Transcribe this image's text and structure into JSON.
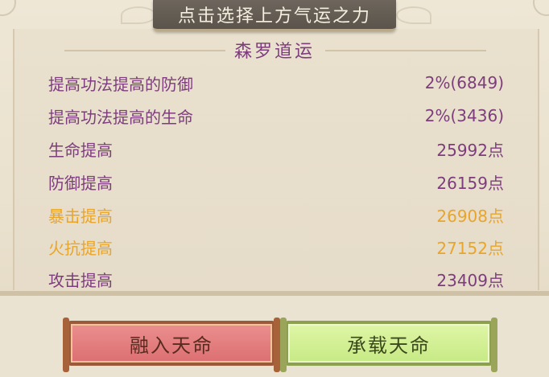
{
  "header": {
    "title": "点击选择上方气运之力"
  },
  "section": {
    "title": "森罗道运"
  },
  "stats": [
    {
      "label": "提高功法提高的防御",
      "value": "2%(6849)",
      "highlight": false
    },
    {
      "label": "提高功法提高的生命",
      "value": "2%(3436)",
      "highlight": false
    },
    {
      "label": "生命提高",
      "value": "25992点",
      "highlight": false
    },
    {
      "label": "防御提高",
      "value": "26159点",
      "highlight": false
    },
    {
      "label": "暴击提高",
      "value": "26908点",
      "highlight": true
    },
    {
      "label": "火抗提高",
      "value": "27152点",
      "highlight": true
    },
    {
      "label": "攻击提高",
      "value": "23409点",
      "highlight": false
    }
  ],
  "buttons": {
    "merge_label": "融入天命",
    "carry_label": "承载天命"
  },
  "colors": {
    "normal_text": "#7d3d7d",
    "highlight_text": "#e8a52a",
    "header_bg": "#6e665d"
  }
}
